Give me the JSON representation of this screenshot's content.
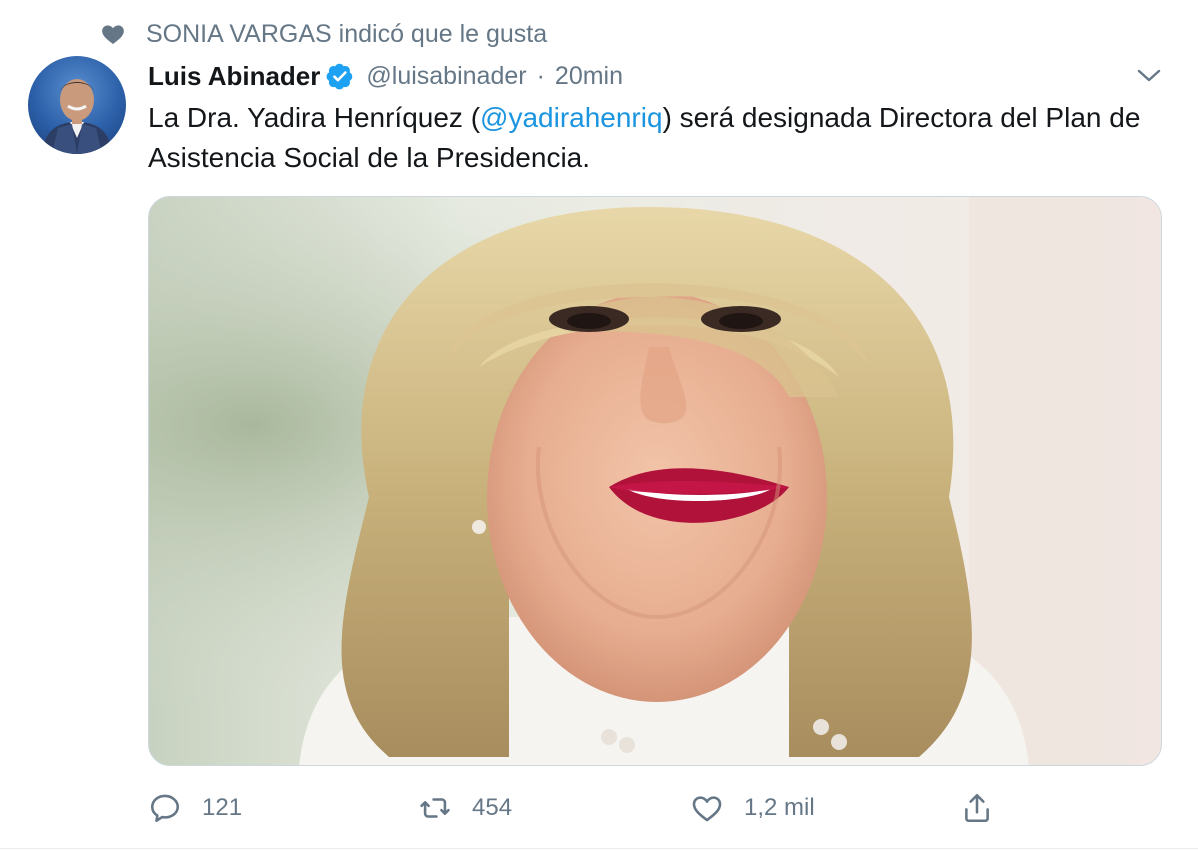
{
  "social_context": {
    "icon": "heart-icon",
    "text": "SONIA VARGAS indicó que le gusta"
  },
  "author": {
    "name": "Luis Abinader",
    "verified_icon": "verified-badge-icon",
    "handle": "@luisabinader",
    "separator": "·",
    "time": "20min"
  },
  "tweet": {
    "text_before": "La Dra. Yadira Henríquez (",
    "mention": "@yadirahenriq",
    "text_after": ") será designada Directora del Plan de Asistencia Social de la Presidencia."
  },
  "actions": {
    "reply_count": "121",
    "retweet_count": "454",
    "like_count": "1,2 mil"
  },
  "colors": {
    "link": "#1b95e0",
    "secondary_text": "#657786",
    "verified": "#1da1f2",
    "border": "#ccd6dd"
  }
}
